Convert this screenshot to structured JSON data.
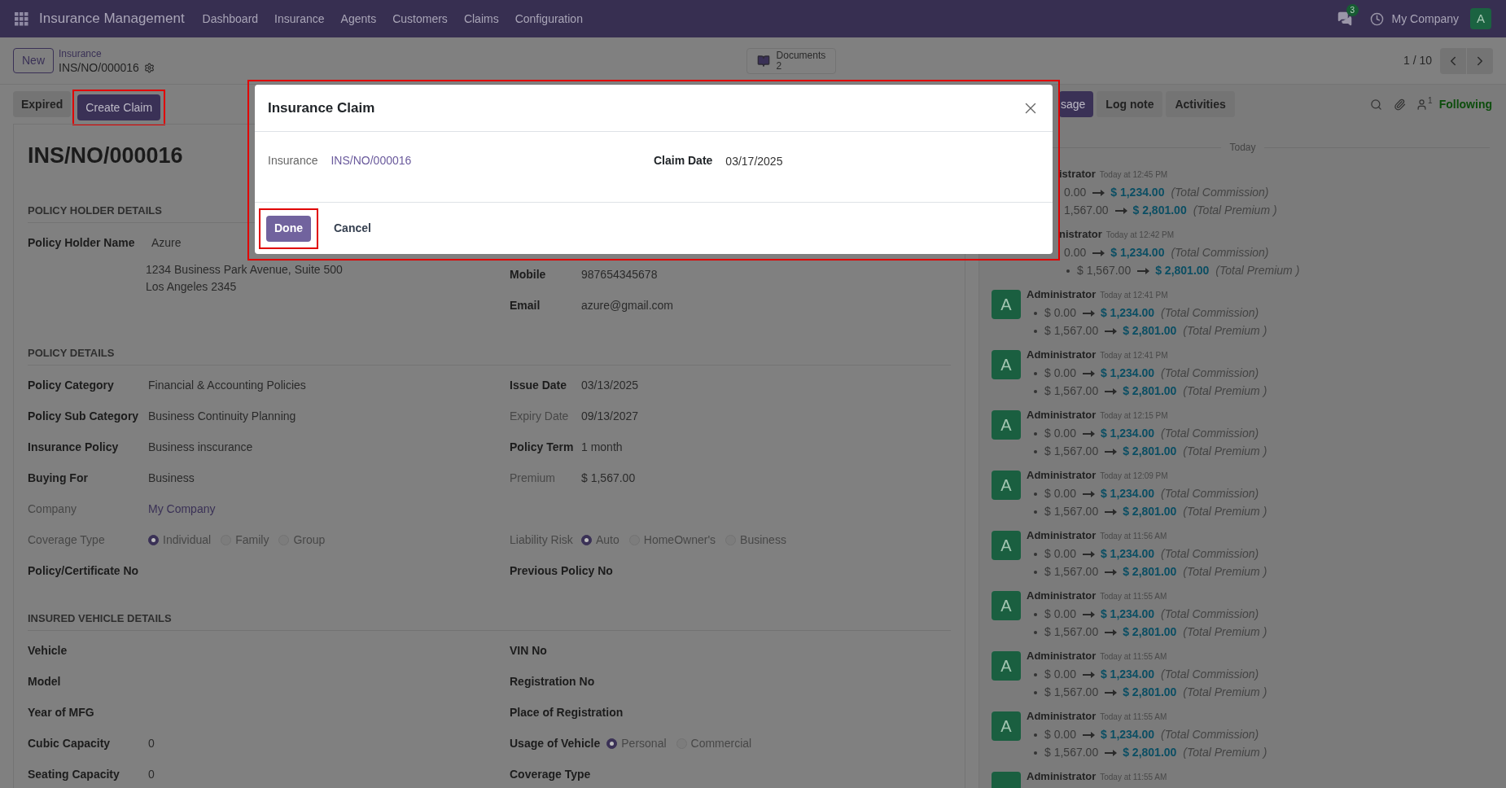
{
  "navbar": {
    "app_title": "Insurance Management",
    "menu": [
      "Dashboard",
      "Insurance",
      "Agents",
      "Customers",
      "Claims",
      "Configuration"
    ],
    "messages_badge": "3",
    "company": "My Company",
    "avatar": "A"
  },
  "control_panel": {
    "new_button": "New",
    "breadcrumb_parent": "Insurance",
    "record": "INS/NO/000016",
    "documents": {
      "label": "Documents",
      "count": "2"
    },
    "pager": "1 / 10"
  },
  "status_buttons": [
    {
      "label": "Expired",
      "kind": "secondary",
      "highlighted": false
    },
    {
      "label": "Create Claim",
      "kind": "primary",
      "highlighted": true
    }
  ],
  "form": {
    "title": "INS/NO/000016",
    "sections": [
      {
        "heading": "POLICY HOLDER DETAILS",
        "kind": "stacked",
        "left": [
          {
            "label": "Policy Holder Name",
            "muted": false,
            "kind": "address",
            "value": "Azure",
            "lines": [
              "1234 Business Park Avenue, Suite 500",
              "Los Angeles 2345"
            ]
          }
        ],
        "right": [
          {
            "label": "Mobile",
            "muted": false,
            "kind": "text",
            "value": "987654345678"
          },
          {
            "label": "Email",
            "muted": false,
            "kind": "text",
            "value": "azure@gmail.com"
          }
        ]
      },
      {
        "heading": "POLICY DETAILS",
        "kind": "paired",
        "rows": [
          {
            "left": {
              "label": "Policy Category",
              "muted": false,
              "kind": "text",
              "value": "Financial & Accounting Policies"
            },
            "right": {
              "label": "Issue Date",
              "muted": false,
              "kind": "text",
              "value": "03/13/2025"
            }
          },
          {
            "left": {
              "label": "Policy Sub Category",
              "muted": false,
              "kind": "text",
              "value": "Business Continuity Planning"
            },
            "right": {
              "label": "Expiry Date",
              "muted": true,
              "kind": "text",
              "value": "09/13/2027"
            }
          },
          {
            "left": {
              "label": "Insurance Policy",
              "muted": false,
              "kind": "text",
              "value": "Business inscurance"
            },
            "right": {
              "label": "Policy Term",
              "muted": false,
              "kind": "text",
              "value": "1 month"
            }
          },
          {
            "left": {
              "label": "Buying For",
              "muted": false,
              "kind": "text",
              "value": "Business"
            },
            "right": {
              "label": "Premium",
              "muted": true,
              "kind": "text",
              "value": "$ 1,567.00"
            }
          },
          {
            "left": {
              "label": "Company",
              "muted": true,
              "kind": "link",
              "value": "My Company"
            }
          },
          {
            "left": {
              "label": "Coverage Type",
              "muted": true,
              "kind": "radio",
              "options": [
                {
                  "label": "Individual",
                  "selected": true
                },
                {
                  "label": "Family",
                  "selected": false
                },
                {
                  "label": "Group",
                  "selected": false
                }
              ]
            },
            "right": {
              "label": "Liability Risk",
              "muted": true,
              "kind": "radio",
              "options": [
                {
                  "label": "Auto",
                  "selected": true
                },
                {
                  "label": "HomeOwner's",
                  "selected": false
                },
                {
                  "label": "Business",
                  "selected": false
                }
              ]
            }
          },
          {
            "left": {
              "label": "Policy/Certificate No",
              "muted": false,
              "kind": "text"
            },
            "right": {
              "label": "Previous Policy No",
              "muted": false,
              "kind": "text"
            }
          }
        ]
      },
      {
        "heading": "INSURED VEHICLE DETAILS",
        "kind": "paired",
        "rows": [
          {
            "left": {
              "label": "Vehicle",
              "muted": false,
              "kind": "text"
            },
            "right": {
              "label": "VIN No",
              "muted": false,
              "kind": "text"
            }
          },
          {
            "left": {
              "label": "Model",
              "muted": false,
              "kind": "text"
            },
            "right": {
              "label": "Registration No",
              "muted": false,
              "kind": "text"
            }
          },
          {
            "left": {
              "label": "Year of MFG",
              "muted": false,
              "kind": "text"
            },
            "right": {
              "label": "Place of Registration",
              "muted": false,
              "kind": "text"
            }
          },
          {
            "left": {
              "label": "Cubic Capacity",
              "muted": false,
              "kind": "text",
              "value": "0"
            },
            "right": {
              "label": "Usage of Vehicle",
              "muted": false,
              "kind": "radio",
              "options": [
                {
                  "label": "Personal",
                  "selected": true
                },
                {
                  "label": "Commercial",
                  "selected": false
                }
              ]
            }
          },
          {
            "left": {
              "label": "Seating Capacity",
              "muted": false,
              "kind": "text",
              "value": "0"
            },
            "right": {
              "label": "Coverage Type",
              "muted": false,
              "kind": "text"
            }
          }
        ]
      }
    ]
  },
  "chatter": {
    "buttons": [
      {
        "label": "sage",
        "kind": "primary"
      },
      {
        "label": "Log note",
        "kind": "secondary"
      },
      {
        "label": "Activities",
        "kind": "secondary"
      }
    ],
    "followers_count": "1",
    "follow_label": "Following",
    "date_separator": "Today",
    "messages": [
      {
        "name": "istrator",
        "time": "Today at 12:45 PM",
        "changes": [
          {
            "bullet": false,
            "old": "0.00",
            "new": "$ 1,234.00",
            "field": "(Total Commission)"
          },
          {
            "bullet": false,
            "old": "1,567.00",
            "new": "$ 2,801.00",
            "field": "(Total Premium )"
          }
        ]
      },
      {
        "name": "nistrator",
        "time": "Today at 12:42 PM",
        "changes": [
          {
            "bullet": false,
            "old": "0.00",
            "new": "$ 1,234.00",
            "field": "(Total Commission)"
          },
          {
            "bullet": true,
            "old": "$ 1,567.00",
            "new": "$ 2,801.00",
            "field": "(Total Premium )"
          }
        ]
      },
      {
        "avatar": "A",
        "name": "Administrator",
        "time": "Today at 12:41 PM",
        "changes": [
          {
            "bullet": true,
            "old": "$ 0.00",
            "new": "$ 1,234.00",
            "field": "(Total Commission)"
          },
          {
            "bullet": true,
            "old": "$ 1,567.00",
            "new": "$ 2,801.00",
            "field": "(Total Premium )"
          }
        ]
      },
      {
        "avatar": "A",
        "name": "Administrator",
        "time": "Today at 12:41 PM",
        "changes": [
          {
            "bullet": true,
            "old": "$ 0.00",
            "new": "$ 1,234.00",
            "field": "(Total Commission)"
          },
          {
            "bullet": true,
            "old": "$ 1,567.00",
            "new": "$ 2,801.00",
            "field": "(Total Premium )"
          }
        ]
      },
      {
        "avatar": "A",
        "name": "Administrator",
        "time": "Today at 12:15 PM",
        "changes": [
          {
            "bullet": true,
            "old": "$ 0.00",
            "new": "$ 1,234.00",
            "field": "(Total Commission)"
          },
          {
            "bullet": true,
            "old": "$ 1,567.00",
            "new": "$ 2,801.00",
            "field": "(Total Premium )"
          }
        ]
      },
      {
        "avatar": "A",
        "name": "Administrator",
        "time": "Today at 12:09 PM",
        "changes": [
          {
            "bullet": true,
            "old": "$ 0.00",
            "new": "$ 1,234.00",
            "field": "(Total Commission)"
          },
          {
            "bullet": true,
            "old": "$ 1,567.00",
            "new": "$ 2,801.00",
            "field": "(Total Premium )"
          }
        ]
      },
      {
        "avatar": "A",
        "name": "Administrator",
        "time": "Today at 11:56 AM",
        "changes": [
          {
            "bullet": true,
            "old": "$ 0.00",
            "new": "$ 1,234.00",
            "field": "(Total Commission)"
          },
          {
            "bullet": true,
            "old": "$ 1,567.00",
            "new": "$ 2,801.00",
            "field": "(Total Premium )"
          }
        ]
      },
      {
        "avatar": "A",
        "name": "Administrator",
        "time": "Today at 11:55 AM",
        "changes": [
          {
            "bullet": true,
            "old": "$ 0.00",
            "new": "$ 1,234.00",
            "field": "(Total Commission)"
          },
          {
            "bullet": true,
            "old": "$ 1,567.00",
            "new": "$ 2,801.00",
            "field": "(Total Premium )"
          }
        ]
      },
      {
        "avatar": "A",
        "name": "Administrator",
        "time": "Today at 11:55 AM",
        "changes": [
          {
            "bullet": true,
            "old": "$ 0.00",
            "new": "$ 1,234.00",
            "field": "(Total Commission)"
          },
          {
            "bullet": true,
            "old": "$ 1,567.00",
            "new": "$ 2,801.00",
            "field": "(Total Premium )"
          }
        ]
      },
      {
        "avatar": "A",
        "name": "Administrator",
        "time": "Today at 11:55 AM",
        "changes": [
          {
            "bullet": true,
            "old": "$ 0.00",
            "new": "$ 1,234.00",
            "field": "(Total Commission)"
          },
          {
            "bullet": true,
            "old": "$ 1,567.00",
            "new": "$ 2,801.00",
            "field": "(Total Premium )"
          }
        ]
      },
      {
        "kind": "cut",
        "name": "Administrator",
        "time": "Today at 11:55 AM"
      }
    ]
  },
  "dialog": {
    "title": "Insurance Claim",
    "highlighted": true,
    "fields": [
      {
        "label": "Insurance",
        "kind": "link",
        "value": "INS/NO/000016"
      },
      {
        "label": "Claim Date",
        "kind": "text",
        "value": "03/17/2025"
      }
    ],
    "buttons": [
      {
        "label": "Done",
        "kind": "primary",
        "highlighted": true
      },
      {
        "label": "Cancel",
        "kind": "secondary",
        "highlighted": false
      }
    ]
  }
}
